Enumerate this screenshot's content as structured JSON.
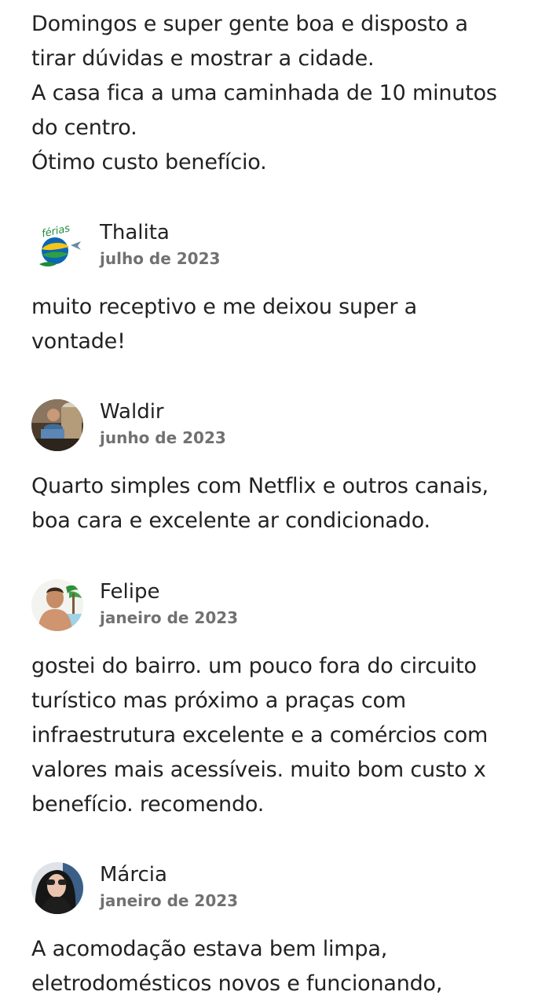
{
  "top_review": {
    "text": "Domingos e super gente boa e disposto a\ntirar dúvidas e mostrar a cidade.\nA casa fica a uma caminhada de 10 minutos\ndo centro.\nÓtimo custo benefício."
  },
  "reviews": [
    {
      "name": "Thalita",
      "date": "julho de 2023",
      "text": "muito receptivo e me deixou super a\nvontade!",
      "avatar_icon": "ferias-logo-avatar",
      "avatar_logo_text": "férias"
    },
    {
      "name": "Waldir",
      "date": "junho de 2023",
      "text": "Quarto simples com Netflix e outros canais,\nboa cara e excelente ar condicionado.",
      "avatar_icon": "user-photo-avatar"
    },
    {
      "name": "Felipe",
      "date": "janeiro de 2023",
      "text": "gostei do bairro. um pouco fora do circuito\nturístico mas próximo a praças com\ninfraestrutura excelente e a comércios com\nvalores mais acessíveis. muito bom custo x\nbenefício. recomendo.",
      "avatar_icon": "user-photo-avatar"
    },
    {
      "name": "Márcia",
      "date": "janeiro de 2023",
      "text": "A acomodação estava bem limpa,\neletrodomésticos novos e funcionando,",
      "avatar_icon": "user-photo-avatar"
    }
  ],
  "colors": {
    "text": "#222222",
    "secondary_text": "#717171",
    "background": "#ffffff"
  }
}
